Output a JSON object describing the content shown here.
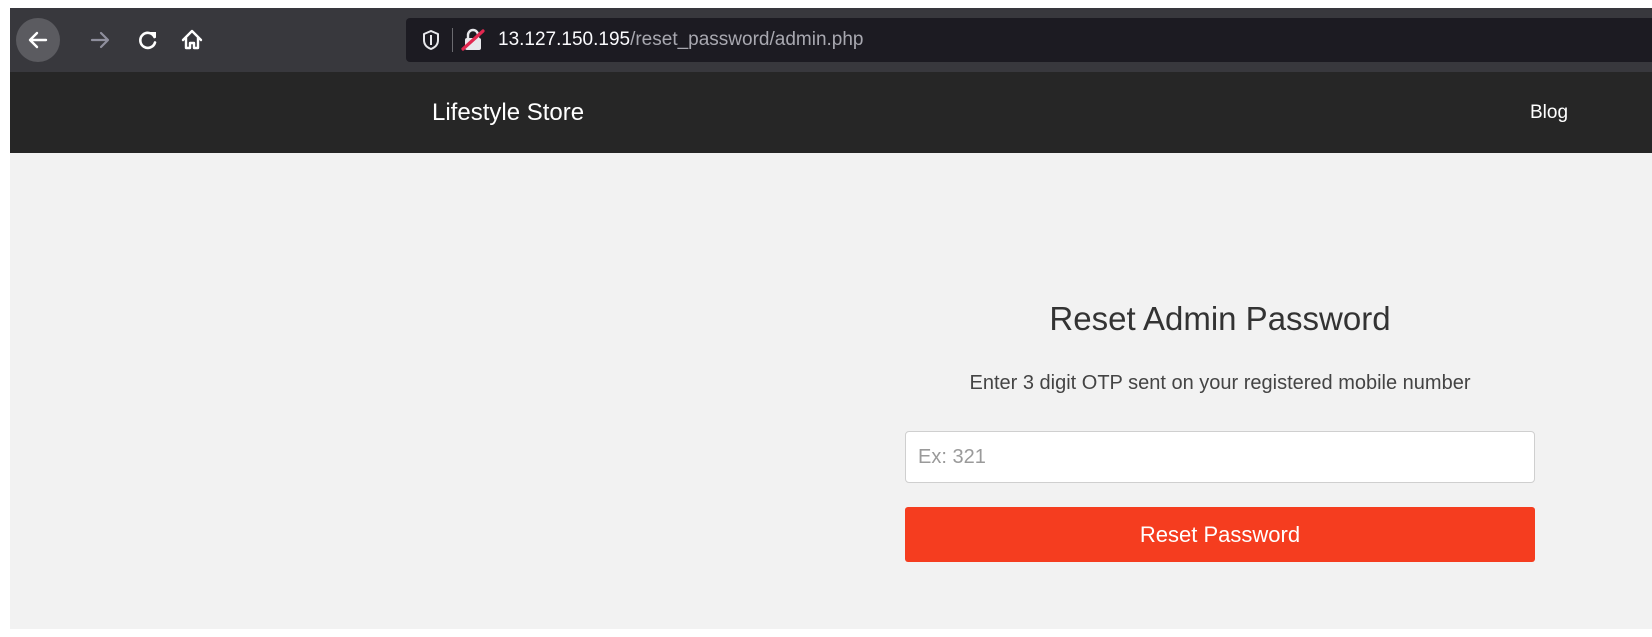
{
  "browser": {
    "url_host": "13.127.150.195",
    "url_path": "/reset_password/admin.php",
    "icons": {
      "back": "back-arrow-icon",
      "forward": "forward-arrow-icon",
      "reload": "reload-icon",
      "home": "home-icon",
      "tracking": "shield-icon",
      "insecure": "insecure-lock-icon"
    }
  },
  "navbar": {
    "brand": "Lifestyle Store",
    "link": "Blog"
  },
  "form": {
    "title": "Reset Admin Password",
    "subtitle": "Enter 3 digit OTP sent on your registered mobile number",
    "otp_placeholder": "Ex: 321",
    "otp_value": "",
    "submit_label": "Reset Password"
  },
  "colors": {
    "navbar_bg": "#262626",
    "page_bg": "#f2f2f2",
    "button_bg": "#f53d1f",
    "insecure_accent": "#e22850"
  }
}
